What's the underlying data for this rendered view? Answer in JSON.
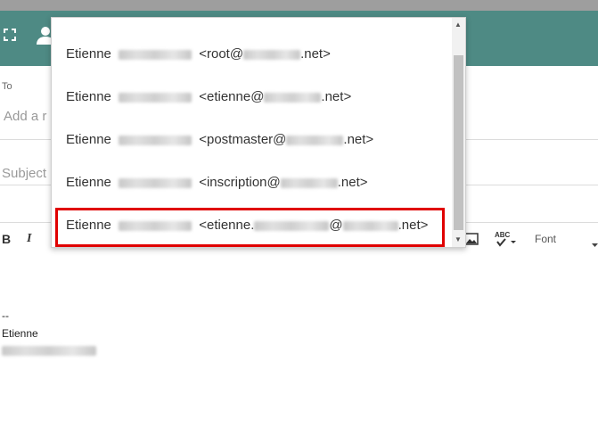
{
  "compose": {
    "to_label": "To",
    "to_placeholder": "Add a r",
    "subject_placeholder": "Subject",
    "toolbar": {
      "bold": "B",
      "italic": "I",
      "font_label": "Font",
      "spell_label": "ABC"
    },
    "body_lines": [
      "--",
      "Etienne"
    ]
  },
  "autocomplete": {
    "items": [
      {
        "name": "Etienne",
        "prefix": "<root@",
        "suffix": ".net>"
      },
      {
        "name": "Etienne",
        "prefix": "<etienne@",
        "suffix": ".net>"
      },
      {
        "name": "Etienne",
        "prefix": "<postmaster@",
        "suffix": ".net>"
      },
      {
        "name": "Etienne",
        "prefix": "<inscription@",
        "suffix": ".net>"
      },
      {
        "name": "Etienne",
        "prefix": "<etienne.",
        "middle": "@",
        "suffix": ".net>",
        "highlighted": true
      }
    ],
    "highlight_color": "#e00000"
  },
  "colors": {
    "header": "#4e8a84",
    "topbar": "#9e9e9e"
  }
}
